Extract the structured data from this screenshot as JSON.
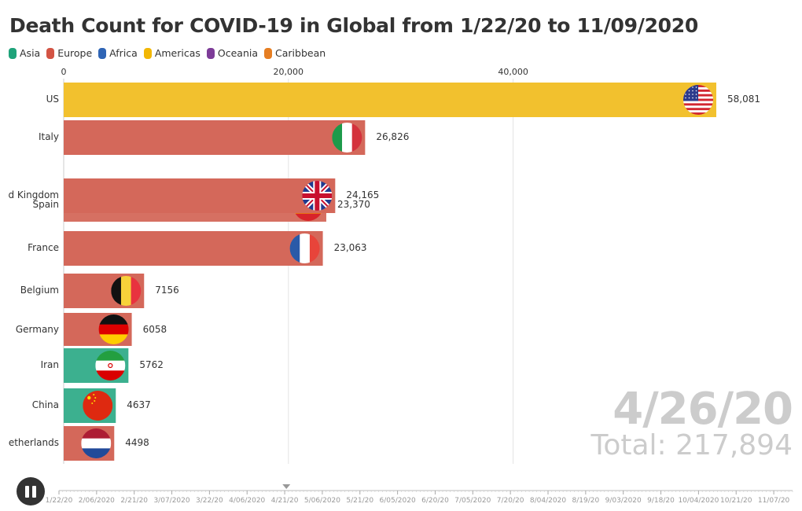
{
  "chart_data": {
    "type": "bar",
    "title": "Death Count for COVID-19 in Global from 1/22/20 to 11/09/2020",
    "legend": [
      {
        "name": "Asia",
        "color": "#1fa37a"
      },
      {
        "name": "Europe",
        "color": "#d35444"
      },
      {
        "name": "Africa",
        "color": "#2f65b5"
      },
      {
        "name": "Americas",
        "color": "#f2b705"
      },
      {
        "name": "Oceania",
        "color": "#7d3c98"
      },
      {
        "name": "Caribbean",
        "color": "#e67e22"
      }
    ],
    "legend_position": "top-left",
    "xlim": [
      0,
      58081
    ],
    "x_ticks": [
      {
        "value": 0,
        "label": "0"
      },
      {
        "value": 20000,
        "label": "20,000"
      },
      {
        "value": 40000,
        "label": "40,000"
      }
    ],
    "grid": true,
    "bars": [
      {
        "country": "US",
        "label": "US",
        "value": 58081,
        "value_label": "58,081",
        "region": "Americas",
        "flag": "us-flag"
      },
      {
        "country": "Italy",
        "label": "Italy",
        "value": 26826,
        "value_label": "26,826",
        "region": "Europe",
        "flag": "italy-flag"
      },
      {
        "country": "United Kingdom",
        "label": "d Kingdom",
        "value": 24165,
        "value_label": "24,165",
        "region": "Europe",
        "flag": "uk-flag"
      },
      {
        "country": "Spain",
        "label": "Spain",
        "value": 23370,
        "value_label": "23,370",
        "region": "Europe",
        "flag": "spain-flag"
      },
      {
        "country": "France",
        "label": "France",
        "value": 23063,
        "value_label": "23,063",
        "region": "Europe",
        "flag": "france-flag"
      },
      {
        "country": "Belgium",
        "label": "Belgium",
        "value": 7156,
        "value_label": "7156",
        "region": "Europe",
        "flag": "belgium-flag"
      },
      {
        "country": "Germany",
        "label": "Germany",
        "value": 6058,
        "value_label": "6058",
        "region": "Europe",
        "flag": "germany-flag"
      },
      {
        "country": "Iran",
        "label": "Iran",
        "value": 5762,
        "value_label": "5762",
        "region": "Asia",
        "flag": "iran-flag"
      },
      {
        "country": "China",
        "label": "China",
        "value": 4637,
        "value_label": "4637",
        "region": "Asia",
        "flag": "china-flag"
      },
      {
        "country": "Netherlands",
        "label": "etherlands",
        "value": 4498,
        "value_label": "4498",
        "region": "Europe",
        "flag": "netherlands-flag"
      }
    ],
    "current_date": "4/26/20",
    "total_label": "Total: 217,894",
    "total": 217894
  },
  "timeline": {
    "labels": [
      "1/22/20",
      "2/06/2020",
      "2/21/20",
      "3/07/2020",
      "3/22/20",
      "4/06/2020",
      "4/21/20",
      "5/06/2020",
      "5/21/20",
      "6/05/2020",
      "6/20/20",
      "7/05/2020",
      "7/20/20",
      "8/04/2020",
      "8/19/20",
      "9/03/2020",
      "9/18/20",
      "10/04/2020",
      "10/21/20",
      "11/07/20"
    ],
    "progress_fraction": 0.31,
    "play_state": "playing"
  }
}
